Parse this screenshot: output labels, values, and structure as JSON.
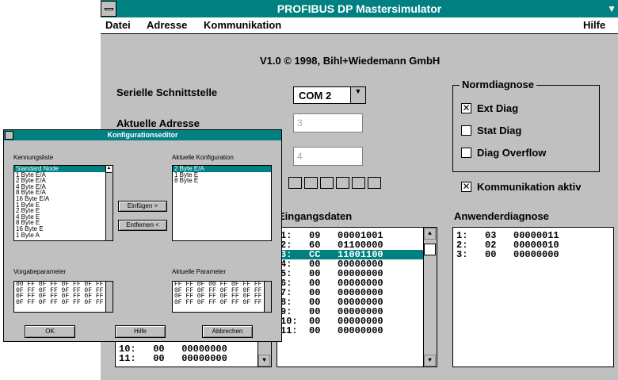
{
  "window": {
    "title": "PROFIBUS DP Mastersimulator"
  },
  "menu": {
    "datei": "Datei",
    "adresse": "Adresse",
    "kommunikation": "Kommunikation",
    "hilfe": "Hilfe"
  },
  "version": "V1.0 © 1998, Bihl+Wiedemann GmbH",
  "serial": {
    "label": "Serielle Schnittstelle",
    "value": "COM 2"
  },
  "address": {
    "label": "Aktuelle Adresse",
    "value": "3",
    "value2": "4"
  },
  "normdiagnose": {
    "title": "Normdiagnose",
    "ext": {
      "label": "Ext Diag",
      "checked": true
    },
    "stat": {
      "label": "Stat Diag",
      "checked": false
    },
    "overflow": {
      "label": "Diag Overflow",
      "checked": false
    }
  },
  "kommunikation_aktiv": {
    "label": "Kommunikation aktiv",
    "checked": true
  },
  "eingangsdaten": {
    "label": "Eingangsdaten",
    "rows": [
      "1:   09   00001001",
      "2:   60   01100000",
      "3:   CC   11001100",
      "4:   00   00000000",
      "5:   00   00000000",
      "6:   00   00000000",
      "7:   00   00000000",
      "8:   00   00000000",
      "9:   00   00000000",
      "10:  00   00000000",
      "11:  00   00000000"
    ],
    "selected_index": 2
  },
  "anwenderdiagnose": {
    "label": "Anwenderdiagnose",
    "rows": [
      "1:   03   00000011",
      "2:   02   00000010",
      "3:   00   00000000"
    ]
  },
  "left_list_rows": [
    "10:   00   00000000",
    "11:   00   00000000"
  ],
  "dialog": {
    "title": "Konfigurationseditor",
    "kennungsliste_label": "Kennungsliste",
    "kennungsliste": [
      "Standard Node",
      "1 Byte E/A",
      "2 Byte E/A",
      "4 Byte E/A",
      "8 Byte E/A",
      "16 Byte E/A",
      "1 Byte E",
      "2 Byte E",
      "4 Byte E",
      "8 Byte E",
      "16 Byte E",
      "1 Byte A"
    ],
    "aktuelle_konfig_label": "Aktuelle Konfiguration",
    "aktuelle_konfig": [
      "2 Byte E/A",
      "1 Byte E",
      "8 Byte E"
    ],
    "einfuegen": "Einfügen >",
    "entfernen": "Entfernen <",
    "vorgabeparameter_label": "Vorgabeparameter",
    "vorgabeparameter": [
      "00 FF 0F FF 0F FF 0F FF",
      "0F FF 0F FF 0F FF 0F FF",
      "0F FF 0F FF 0F FF 0F FF",
      "0F FF 0F FF 0F FF 0F FF"
    ],
    "aktuelle_parameter_label": "Aktuelle Parameter",
    "aktuelle_parameter": [
      "FF FF 0F 00 FF 0F FF FF",
      "0F FF 0F FF 0F FF 0F FF",
      "0F FF 0F FF 0F FF 0F FF",
      "0F FF 0F FF 0F FF 0F FF"
    ],
    "ok": "OK",
    "hilfe": "Hilfe",
    "abbrechen": "Abbrechen"
  },
  "colors": {
    "titlebar": "#008080",
    "background": "#c0c0c0",
    "selection": "#008080"
  }
}
